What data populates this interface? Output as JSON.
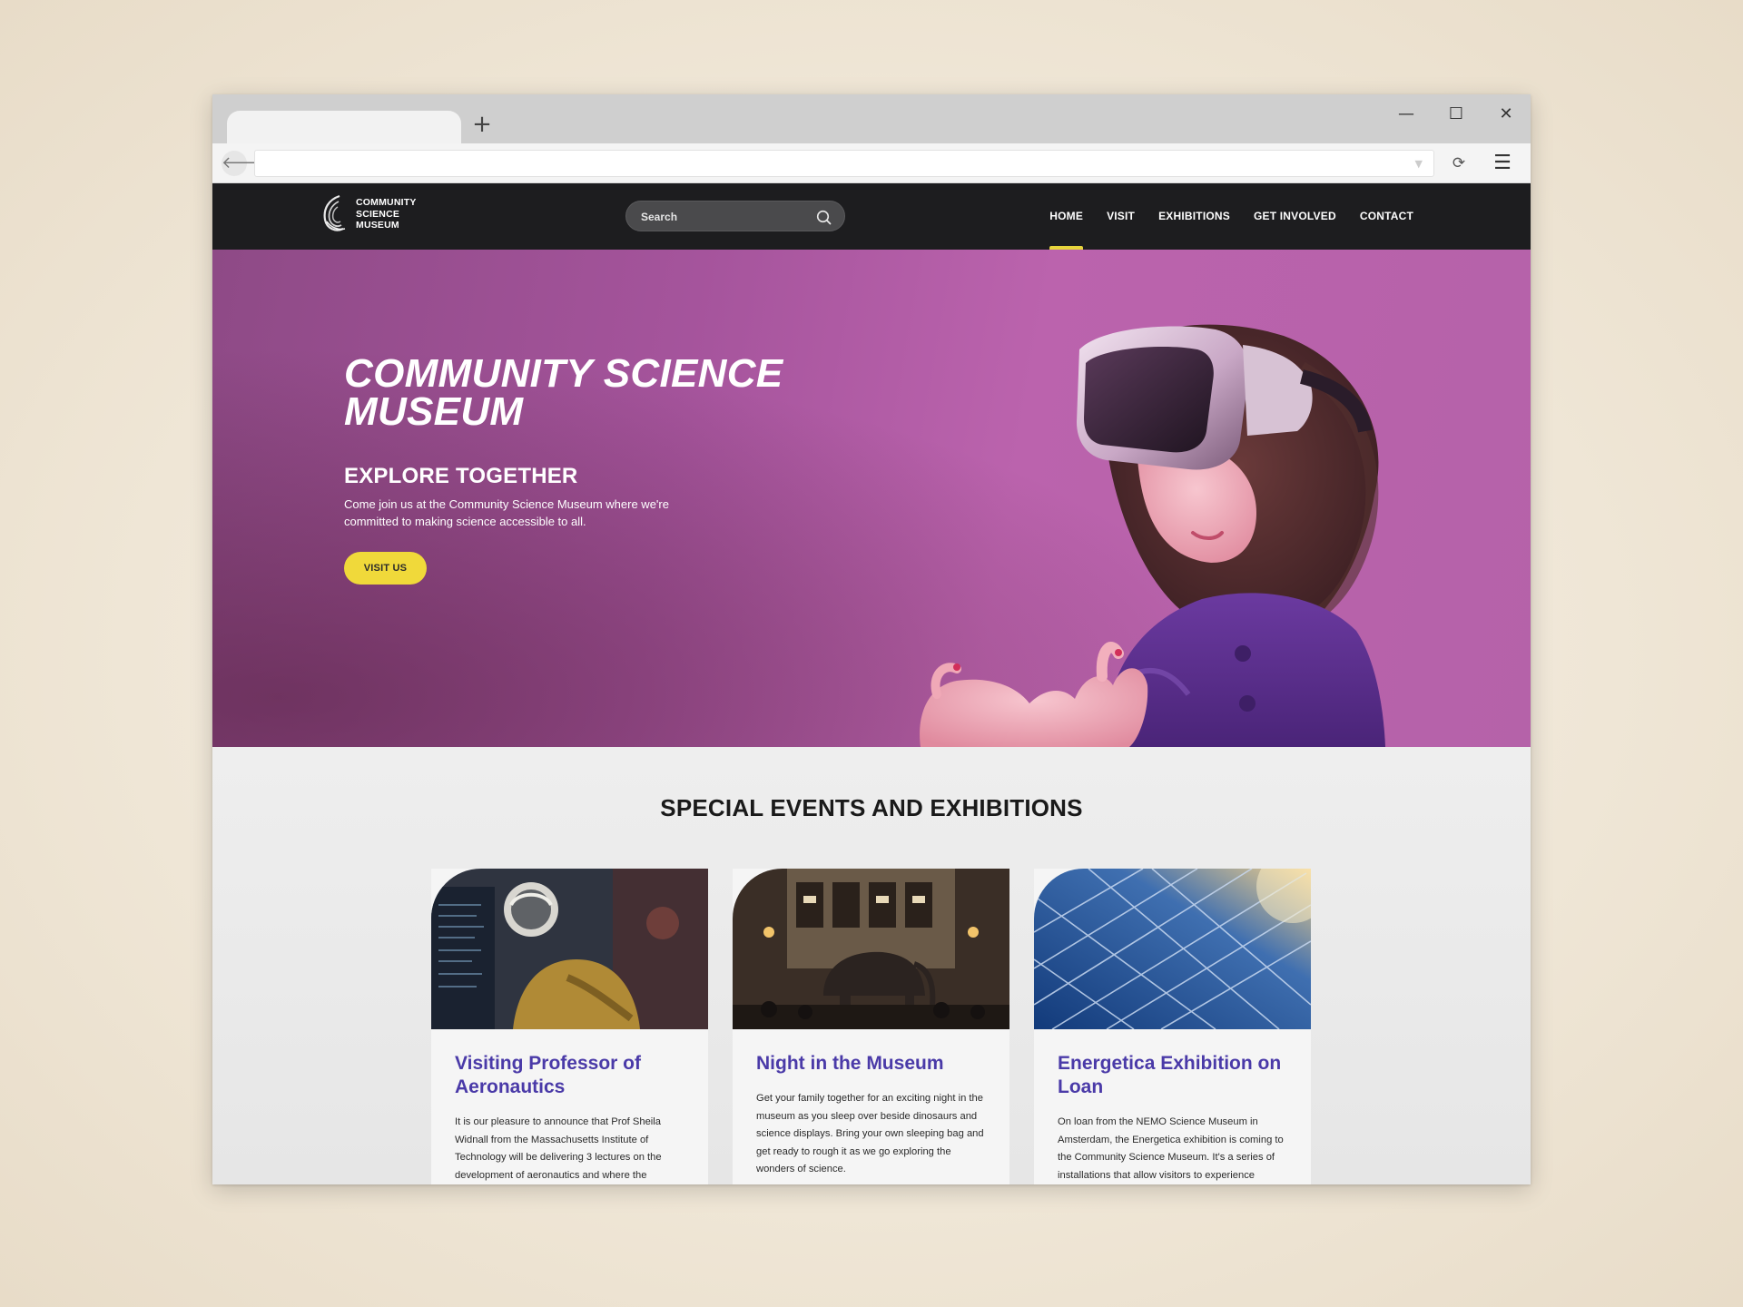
{
  "browser": {
    "tab_title": "",
    "new_tab_icon": "+",
    "window_controls": {
      "minimize": "—",
      "maximize": "☐",
      "close": "✕"
    },
    "back_icon": "🡐",
    "reload_icon": "⟳",
    "menu_icon": "☰",
    "url": ""
  },
  "site": {
    "logo_lines": [
      "COMMUNITY",
      "SCIENCE",
      "MUSEUM"
    ],
    "search_placeholder": "Search",
    "nav": [
      {
        "label": "HOME",
        "active": true
      },
      {
        "label": "VISIT",
        "active": false
      },
      {
        "label": "EXHIBITIONS",
        "active": false
      },
      {
        "label": "GET INVOLVED",
        "active": false
      },
      {
        "label": "CONTACT",
        "active": false
      }
    ],
    "accent_color": "#f0d93a",
    "header_color": "#1d1d1f"
  },
  "hero": {
    "title_line1": "COMMUNITY SCIENCE",
    "title_line2": "MUSEUM",
    "subtitle": "EXPLORE TOGETHER",
    "description": "Come join us at the Community Science Museum where we're committed to making science accessible to all.",
    "cta": "VISIT US",
    "background_color": "#b15aa4"
  },
  "events": {
    "heading": "SPECIAL EVENTS AND EXHIBITIONS",
    "cards": [
      {
        "title": "Visiting Professor of Aeronautics",
        "body": "It is our pleasure to announce that Prof Sheila Widnall from the Massachusetts Institute of Technology will be delivering 3 lectures on the development of aeronautics and where the"
      },
      {
        "title": "Night in the Museum",
        "body": "Get your family together for an exciting night in the museum as you sleep over beside dinosaurs and science displays. Bring your own sleeping bag and get ready to rough it as we go exploring the wonders of science."
      },
      {
        "title": "Energetica Exhibition on Loan",
        "body": "On loan from the NEMO Science Museum in Amsterdam, the Energetica exhibition is coming to the Community Science Museum. It's a series of installations that allow visitors to experience"
      }
    ],
    "title_color": "#4a3aa8"
  }
}
